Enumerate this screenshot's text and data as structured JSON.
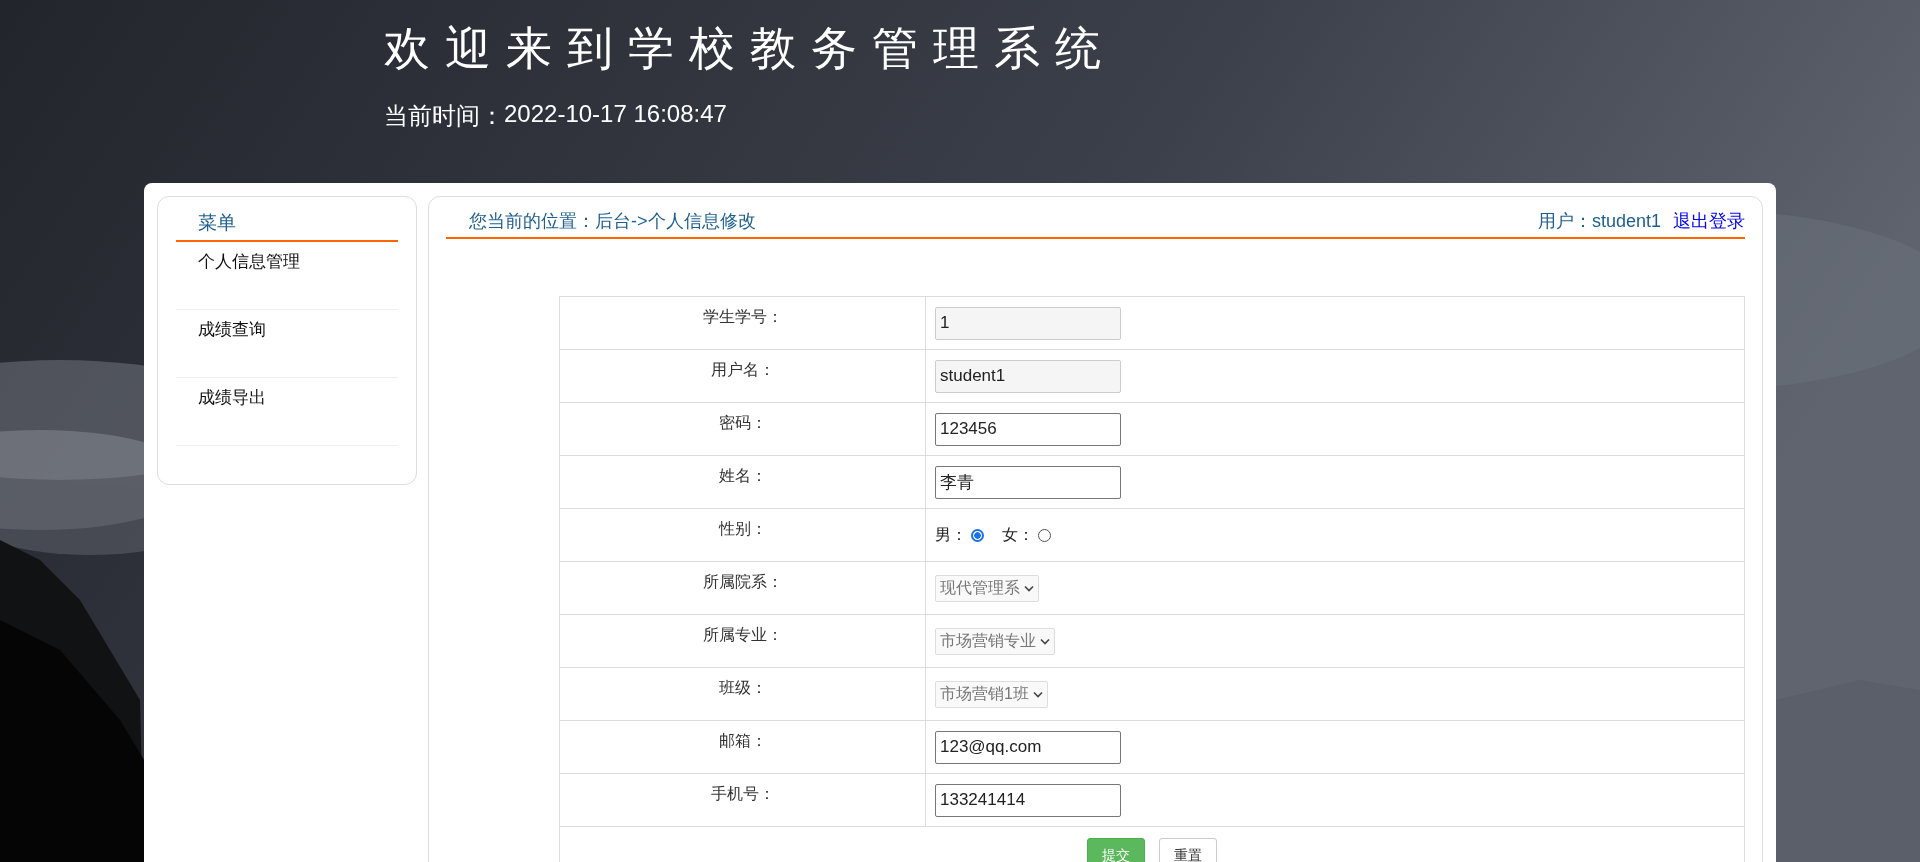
{
  "header": {
    "title": "欢迎来到学校教务管理系统",
    "time_label": "当前时间：",
    "time": "2022-10-17 16:08:47"
  },
  "menu": {
    "title": "菜单",
    "items": [
      {
        "label": "个人信息管理"
      },
      {
        "label": "成绩查询"
      },
      {
        "label": "成绩导出"
      }
    ]
  },
  "breadcrumb": {
    "label": "您当前的位置：",
    "path": "后台->个人信息修改"
  },
  "user": {
    "label": "用户：",
    "name": "student1",
    "logout": "退出登录"
  },
  "form": {
    "rows": [
      {
        "label": "学生学号：",
        "kind": "text",
        "value": "1",
        "readonly": true
      },
      {
        "label": "用户名：",
        "kind": "text",
        "value": "student1",
        "readonly": true
      },
      {
        "label": "密码：",
        "kind": "text",
        "value": "123456",
        "readonly": false
      },
      {
        "label": "姓名：",
        "kind": "text",
        "value": "李青",
        "readonly": false
      },
      {
        "label": "性别：",
        "kind": "radio",
        "options": [
          {
            "label": "男：",
            "selected": true
          },
          {
            "label": "女：",
            "selected": false
          }
        ]
      },
      {
        "label": "所属院系：",
        "kind": "select",
        "value": "现代管理系"
      },
      {
        "label": "所属专业：",
        "kind": "select",
        "value": "市场营销专业"
      },
      {
        "label": "班级：",
        "kind": "select",
        "value": "市场营销1班"
      },
      {
        "label": "邮箱：",
        "kind": "text",
        "value": "123@qq.com",
        "readonly": false
      },
      {
        "label": "手机号：",
        "kind": "text",
        "value": "133241414",
        "readonly": false
      }
    ],
    "buttons": [
      {
        "label": "提交",
        "kind": "primary"
      },
      {
        "label": "重置",
        "kind": "default"
      }
    ]
  }
}
